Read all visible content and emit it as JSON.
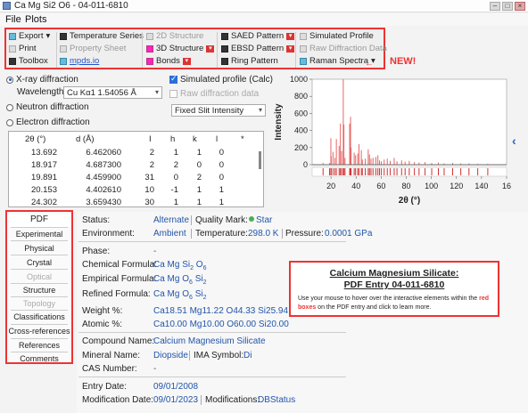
{
  "window": {
    "title": "Ca Mg Si2 O6 - 04-011-6810"
  },
  "menu": [
    "File",
    "Plots"
  ],
  "toolbar": {
    "export": "Export",
    "print": "Print",
    "toolbox": "Toolbox",
    "temperature_series": "Temperature Series",
    "property_sheet": "Property Sheet",
    "mpds": "mpds.io",
    "structure_2d": "2D Structure",
    "structure_3d": "3D Structure",
    "bonds": "Bonds",
    "saed": "SAED Pattern",
    "ebsd": "EBSD Pattern",
    "ring": "Ring Pattern",
    "simulated_profile": "Simulated Profile",
    "raw_diffraction": "Raw Diffraction Data",
    "raman": "Raman Spectra",
    "new_label": "NEW!"
  },
  "diffraction": {
    "xray": "X-ray diffraction",
    "neutron": "Neutron diffraction",
    "electron": "Electron diffraction",
    "wavelength_label": "Wavelength:",
    "wavelength_value": "Cu Kα1 1.54056 Å",
    "sim_profile": "Simulated profile (Calc)",
    "raw_data": "Raw diffraction data",
    "slit": "Fixed Slit Intensity"
  },
  "table": {
    "headers": [
      "2θ (°)",
      "d (Å)",
      "I",
      "h",
      "k",
      "l",
      "*"
    ],
    "rows": [
      [
        "13.692",
        "6.462060",
        "2",
        "1",
        "1",
        "0"
      ],
      [
        "18.917",
        "4.687300",
        "2",
        "2",
        "0",
        "0"
      ],
      [
        "19.891",
        "4.459900",
        "31",
        "0",
        "2",
        "0"
      ],
      [
        "20.153",
        "4.402610",
        "10",
        "-1",
        "1",
        "1"
      ],
      [
        "24.302",
        "3.659430",
        "30",
        "1",
        "1",
        "1"
      ]
    ]
  },
  "chart_data": {
    "type": "bar",
    "xlabel": "2θ (°)",
    "ylabel": "Intensity",
    "xlim": [
      5,
      160
    ],
    "ylim": [
      0,
      1000
    ],
    "xticks": [
      20,
      40,
      60,
      80,
      100,
      120,
      140,
      160
    ],
    "xtick_labels": [
      "20",
      "40",
      "60",
      "80",
      "100",
      "120",
      "140",
      "16"
    ],
    "yticks": [
      0,
      200,
      400,
      600,
      800,
      1000
    ],
    "colors": {
      "bars": "#e66666",
      "markers": "#cc3333"
    },
    "peaks": [
      {
        "x": 13.7,
        "y": 20
      },
      {
        "x": 18.9,
        "y": 20
      },
      {
        "x": 19.9,
        "y": 310
      },
      {
        "x": 20.2,
        "y": 100
      },
      {
        "x": 21.6,
        "y": 150
      },
      {
        "x": 23.1,
        "y": 80
      },
      {
        "x": 24.3,
        "y": 300
      },
      {
        "x": 26.5,
        "y": 220
      },
      {
        "x": 27.5,
        "y": 480
      },
      {
        "x": 28.5,
        "y": 160
      },
      {
        "x": 29.8,
        "y": 1000
      },
      {
        "x": 30.3,
        "y": 470
      },
      {
        "x": 31.2,
        "y": 80
      },
      {
        "x": 34.9,
        "y": 480
      },
      {
        "x": 35.6,
        "y": 560
      },
      {
        "x": 36.0,
        "y": 200
      },
      {
        "x": 38.5,
        "y": 140
      },
      {
        "x": 39.6,
        "y": 110
      },
      {
        "x": 41.3,
        "y": 130
      },
      {
        "x": 42.3,
        "y": 240
      },
      {
        "x": 44.2,
        "y": 170
      },
      {
        "x": 45.0,
        "y": 60
      },
      {
        "x": 47.3,
        "y": 70
      },
      {
        "x": 49.7,
        "y": 180
      },
      {
        "x": 50.7,
        "y": 120
      },
      {
        "x": 51.9,
        "y": 70
      },
      {
        "x": 53.5,
        "y": 80
      },
      {
        "x": 55.8,
        "y": 90
      },
      {
        "x": 57.4,
        "y": 110
      },
      {
        "x": 58.7,
        "y": 50
      },
      {
        "x": 60.2,
        "y": 40
      },
      {
        "x": 62.4,
        "y": 60
      },
      {
        "x": 64.9,
        "y": 70
      },
      {
        "x": 67.2,
        "y": 45
      },
      {
        "x": 70.4,
        "y": 80
      },
      {
        "x": 72.6,
        "y": 40
      },
      {
        "x": 76.3,
        "y": 50
      },
      {
        "x": 79.1,
        "y": 35
      },
      {
        "x": 82.4,
        "y": 45
      },
      {
        "x": 86.5,
        "y": 30
      },
      {
        "x": 90.2,
        "y": 25
      },
      {
        "x": 95.0,
        "y": 30
      },
      {
        "x": 100.3,
        "y": 20
      },
      {
        "x": 105.6,
        "y": 25
      },
      {
        "x": 110.2,
        "y": 15
      },
      {
        "x": 117.0,
        "y": 20
      },
      {
        "x": 123.5,
        "y": 15
      },
      {
        "x": 130.0,
        "y": 15
      },
      {
        "x": 137.0,
        "y": 10
      },
      {
        "x": 145.0,
        "y": 10
      }
    ]
  },
  "nav": {
    "items": [
      "PDF",
      "Experimental",
      "Physical",
      "Crystal",
      "Optical",
      "Structure",
      "Topology",
      "Classifications",
      "Cross-references",
      "References",
      "Comments"
    ]
  },
  "info": {
    "status_label": "Status:",
    "status_value": "Alternate",
    "quality_label": "Quality Mark:",
    "quality_value": "Star",
    "environment_label": "Environment:",
    "environment_value": "Ambient",
    "temperature_label": "Temperature:",
    "temperature_value": "298.0 K",
    "pressure_label": "Pressure:",
    "pressure_value": "0.0001 GPa",
    "phase_label": "Phase:",
    "phase_value": "-",
    "chem_formula_label": "Chemical Formula:",
    "chem_formula": [
      "Ca Mg Si",
      "2",
      " O",
      "6"
    ],
    "emp_formula_label": "Empirical Formula:",
    "emp_formula": [
      "Ca Mg O",
      "6",
      " Si",
      "2"
    ],
    "ref_formula_label": "Refined Formula:",
    "ref_formula": [
      "Ca Mg O",
      "6",
      " Si",
      "2"
    ],
    "weight_label": "Weight %:",
    "weight_value": "Ca18.51 Mg11.22 O44.33 Si25.94",
    "atomic_label": "Atomic %:",
    "atomic_value": "Ca10.00 Mg10.00 O60.00 Si20.00",
    "compound_label": "Compound Name:",
    "compound_value": "Calcium Magnesium Silicate",
    "mineral_label": "Mineral Name:",
    "mineral_value": "Diopside",
    "ima_label": "IMA Symbol:",
    "ima_value": "Di",
    "cas_label": "CAS Number:",
    "cas_value": "-",
    "entry_label": "Entry Date:",
    "entry_value": "09/01/2008",
    "mod_label": "Modification Date:",
    "mod_value": "09/01/2023",
    "mods_label": "Modifications:",
    "mods_value": "DBStatus"
  },
  "callout": {
    "title1": "Calcium Magnesium Silicate:",
    "title2": "PDF Entry 04-011-6810",
    "body_pre": "Use your mouse to hover over the interactive elements within the ",
    "body_red": "red boxes",
    "body_post": " on the PDF entry and click to learn more."
  }
}
